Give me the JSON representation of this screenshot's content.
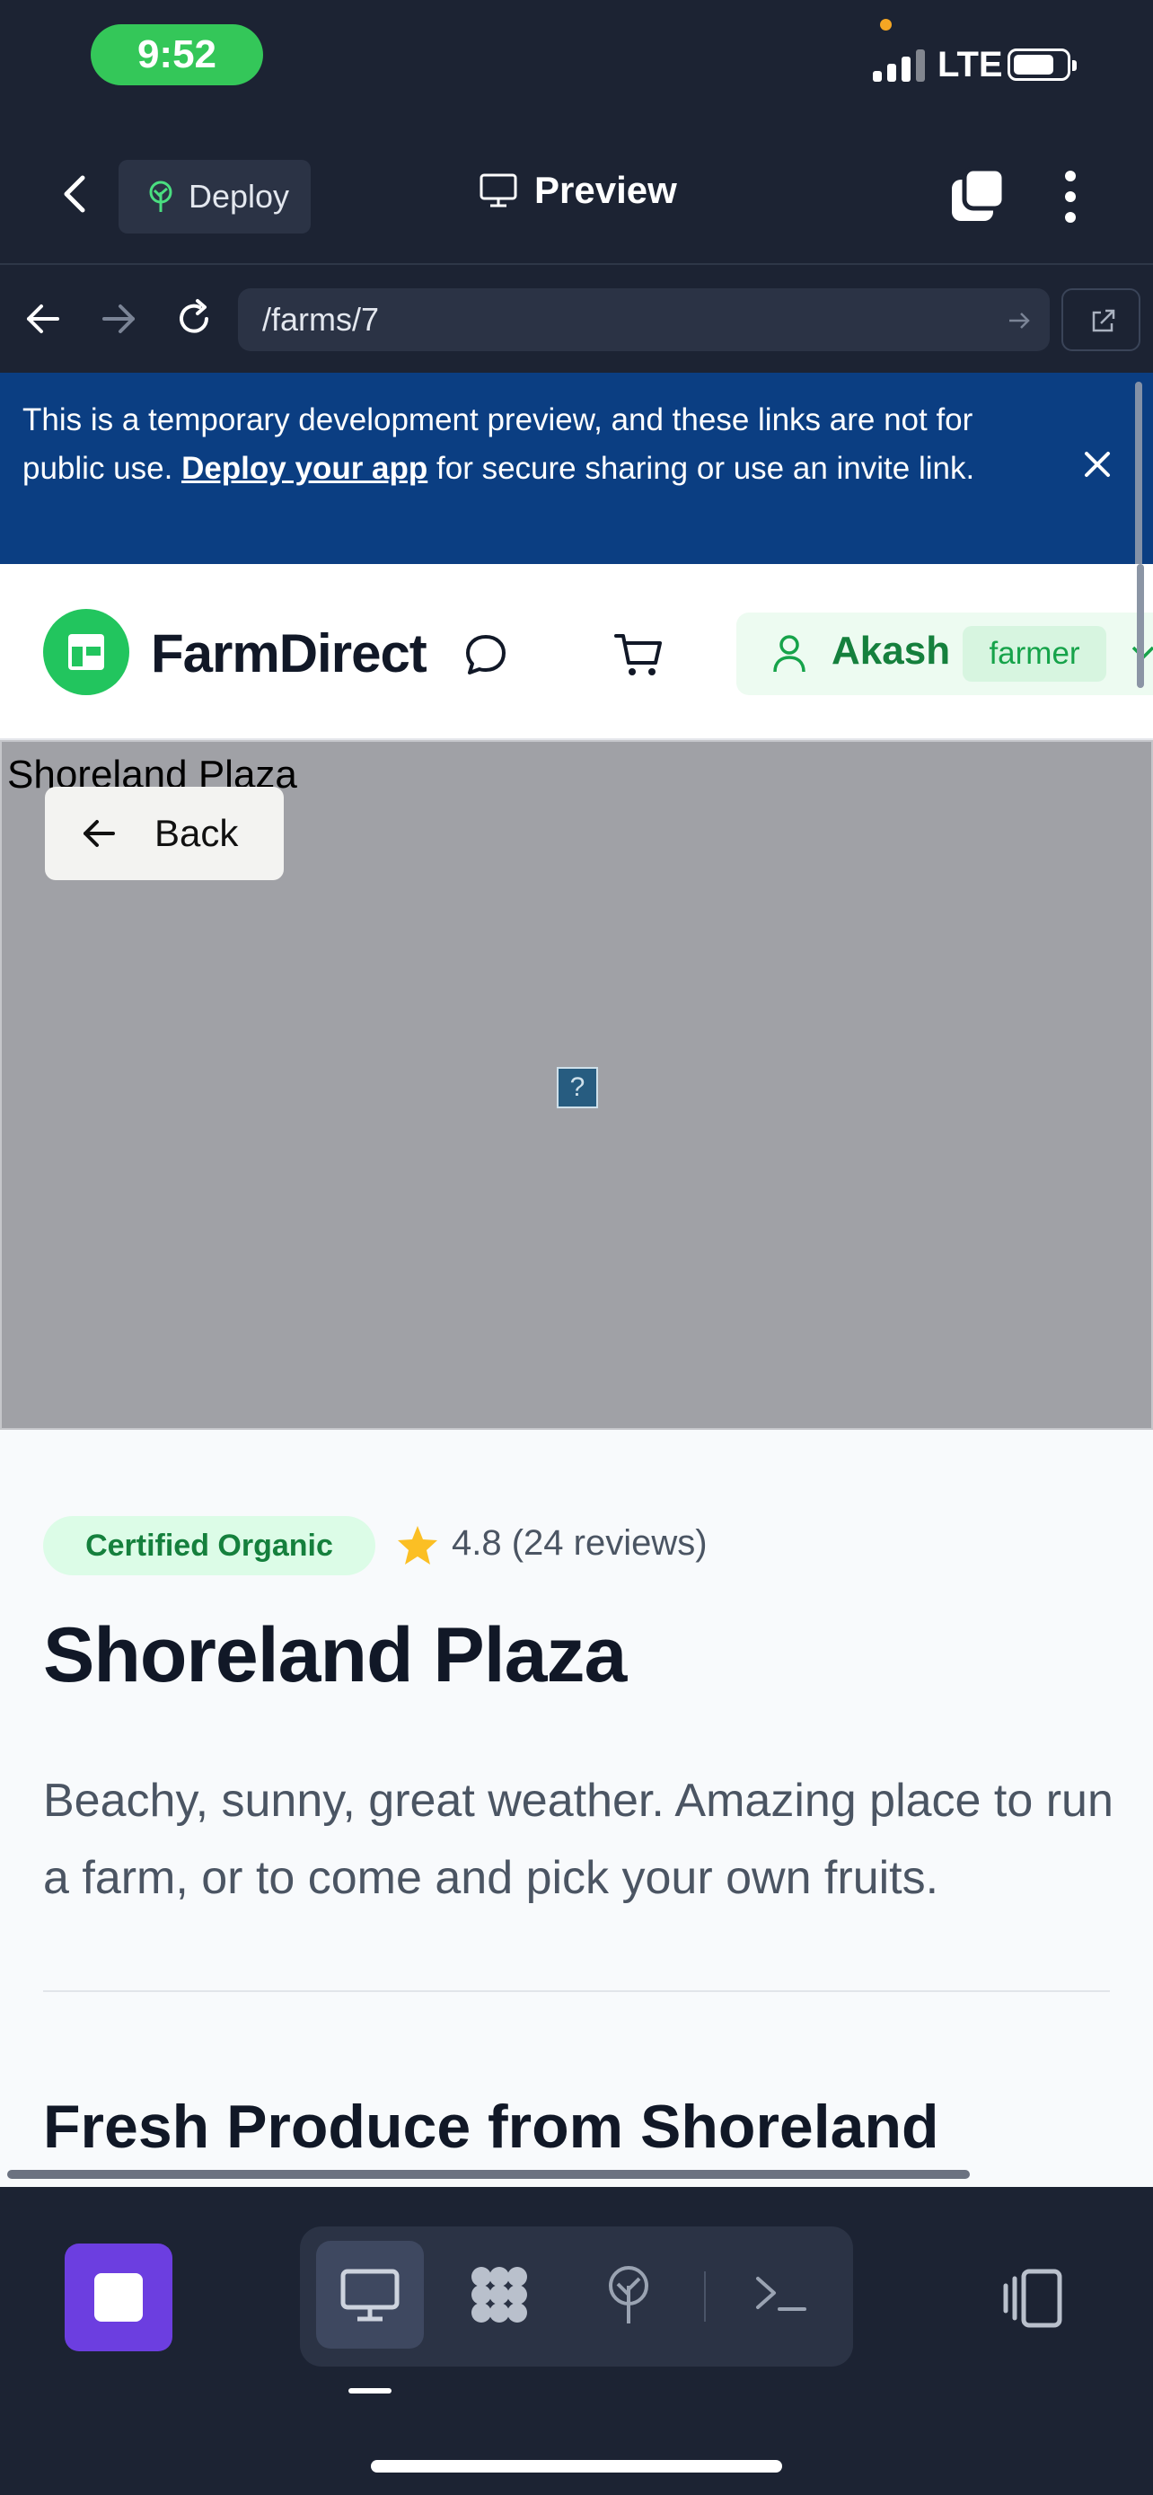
{
  "status_bar": {
    "time": "9:52",
    "network": "LTE"
  },
  "app_header": {
    "deploy_label": "Deploy",
    "title": "Preview"
  },
  "url_bar": {
    "url": "/farms/7"
  },
  "banner": {
    "text_before": "This is a temporary development preview, and these links are not for public use. ",
    "link": "Deploy your app",
    "text_after": " for secure sharing or use an invite link."
  },
  "site_nav": {
    "brand": "FarmDirect",
    "user_name": "Akash",
    "user_role": "farmer"
  },
  "hero": {
    "image_alt": "Shoreland Plaza",
    "back_label": "Back",
    "broken_image_glyph": "?"
  },
  "farm": {
    "badge": "Certified Organic",
    "rating": "4.8 (24 reviews)",
    "title": "Shoreland Plaza",
    "description": "Beachy, sunny, great weather. Amazing place to run a farm, or to come and pick your own fruits.",
    "section_title": "Fresh Produce from Shoreland Plaza"
  },
  "icons": {
    "back": "chevron-left-icon",
    "deploy": "deploy-tree-icon",
    "preview": "monitor-icon",
    "tabs": "tabs-icon",
    "menu": "kebab-menu-icon",
    "close": "close-icon",
    "chat": "chat-icon",
    "cart": "cart-icon",
    "user": "user-icon",
    "star": "star-icon"
  },
  "colors": {
    "brand_green": "#22c55e",
    "banner_blue": "#0b3e82",
    "dark_bg": "#1c2333",
    "stop_purple": "#6c3ee0",
    "star": "#fbbf24"
  }
}
